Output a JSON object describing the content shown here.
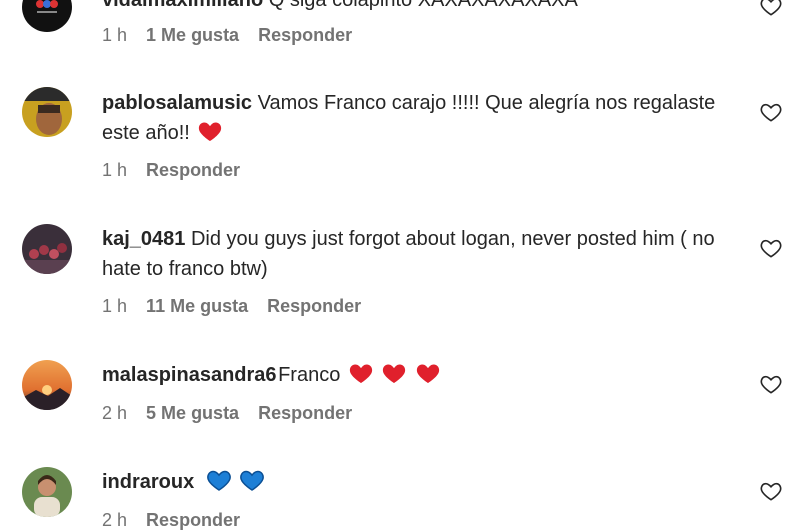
{
  "comments": [
    {
      "username": "vidalmaximiliano",
      "text": "Q siga colapinto XAXAXAXAXAXA",
      "time": "1 h",
      "likes": "1 Me gusta",
      "reply": "Responder",
      "avatar_icon": "avatar-image"
    },
    {
      "username": "pablosalamusic",
      "text": "Vamos Franco carajo !!!!! Que alegría nos regalaste este año!!",
      "emojis": [
        "red-heart"
      ],
      "time": "1 h",
      "reply": "Responder",
      "avatar_icon": "avatar-image"
    },
    {
      "username": "kaj_0481",
      "text": "Did you guys just forgot about logan, never posted him ( no hate to franco btw)",
      "time": "1 h",
      "likes": "11 Me gusta",
      "reply": "Responder",
      "avatar_icon": "avatar-image"
    },
    {
      "username": "malaspinasandra6",
      "text": "Franco",
      "emojis": [
        "red-heart",
        "red-heart",
        "red-heart"
      ],
      "time": "2 h",
      "likes": "5 Me gusta",
      "reply": "Responder",
      "avatar_icon": "avatar-image"
    },
    {
      "username": "indraroux",
      "text": "",
      "emojis": [
        "blue-heart",
        "blue-heart"
      ],
      "time": "2 h",
      "reply": "Responder",
      "avatar_icon": "avatar-image"
    }
  ],
  "colors": {
    "text": "#262626",
    "meta": "#737373",
    "red_heart": "#e0202c",
    "blue_heart": "#1d7fd6"
  },
  "icons": {
    "like": "heart-outline-icon"
  }
}
